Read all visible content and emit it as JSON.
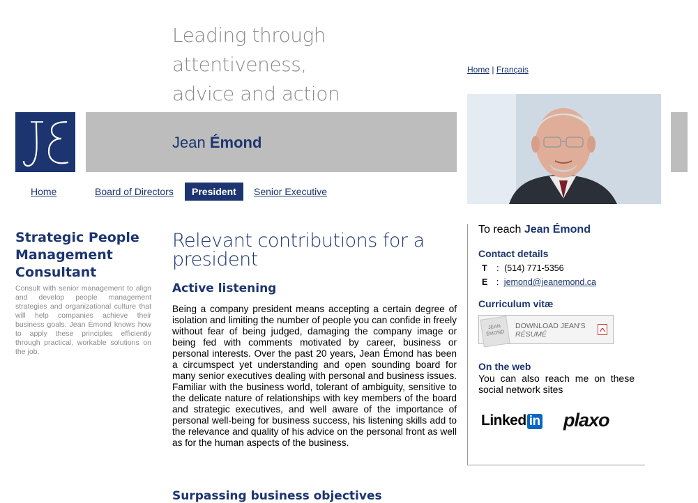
{
  "tagline": {
    "line1": "Leading through attentiveness,",
    "line2": "advice and action"
  },
  "topnav": {
    "home": "Home",
    "separator": "|",
    "french": "Français"
  },
  "banner": {
    "first_name": "Jean",
    "last_name": "Émond"
  },
  "mainnav": [
    {
      "label": "Home"
    },
    {
      "label": "Board of Directors"
    },
    {
      "label": "President"
    },
    {
      "label": "Senior Executive"
    }
  ],
  "left": {
    "title": "Strategic People Management Consultant",
    "text": "Consult with senior management to align and develop people management strategies and organizational culture that will help companies achieve their business goals. Jean Émond knows how to apply these principles efficiently through practical, workable solutions on the job."
  },
  "main": {
    "heading": "Relevant contributions for a president",
    "subheading1": "Active listening",
    "paragraph": "Being a company president means accepting a certain degree of isolation and limiting the number of people you can confide in freely without fear of being judged, damaging the company image or being fed with comments motivated by career, business or personal interests. Over the past 20 years, Jean Émond has been a circumspect yet understanding and open sounding board for many senior executives dealing with personal and business issues. Familiar with the business world, tolerant of ambiguity, sensitive to the delicate nature of relationships with key members of the board and strategic executives, and well aware of the importance of personal well-being for business success, his listening skills add to the relevance and quality of his advice on the personal front as well as for the human aspects of the business.",
    "subheading2": "Surpassing business objectives"
  },
  "sidebar": {
    "reach_prefix": "To reach",
    "reach_name": "Jean Émond",
    "contact_title": "Contact details",
    "phone_label": "T",
    "phone_sep": ":",
    "phone": "(514) 771-5356",
    "email_label": "E",
    "email_sep": ":",
    "email": "jemond@jeanemond.ca",
    "cv_title": "Curriculum vitæ",
    "cv_thumb": "JEAN ÉMOND",
    "cv_line1": "DOWNLOAD JEAN'S",
    "cv_line2": "RÉSUMÉ",
    "web_title": "On the web",
    "web_text": "You can also reach me on these social network sites",
    "linkedin": "Linked",
    "linkedin_in": "in",
    "plaxo": "plaxo"
  },
  "colors": {
    "brand": "#1c3570",
    "banner_gray": "#bdbdbd",
    "muted_text": "#8a8a8a"
  }
}
